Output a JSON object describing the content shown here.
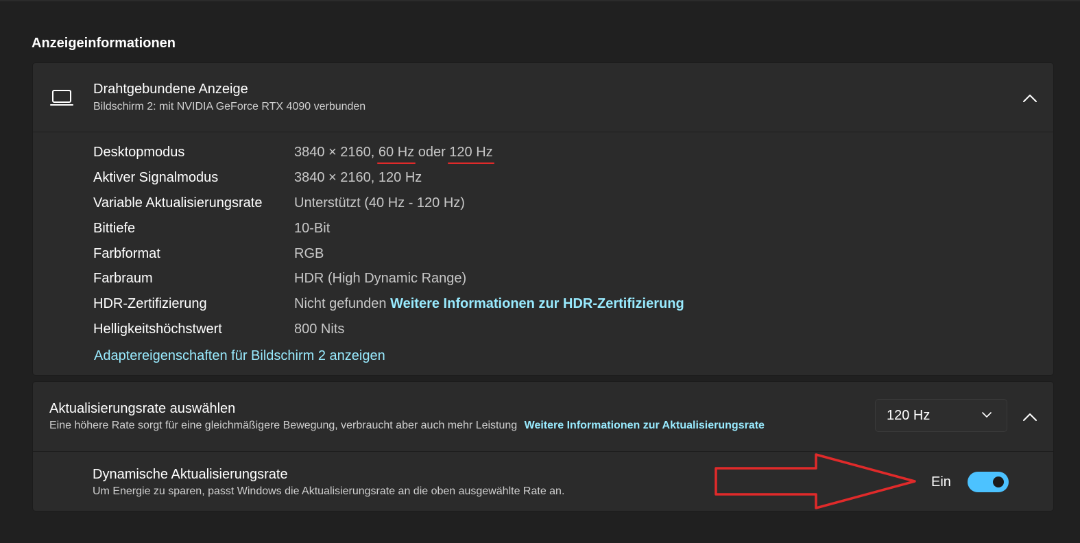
{
  "section_title": "Anzeigeinformationen",
  "display_card": {
    "title": "Drahtgebundene Anzeige",
    "subtitle": "Bildschirm 2: mit NVIDIA GeForce RTX 4090 verbunden",
    "icon": "laptop-icon",
    "expanded": true,
    "rows": [
      {
        "label": "Desktopmodus",
        "value_prefix": "3840 × 2160, ",
        "value_hz1": "60 Hz",
        "value_mid": " oder ",
        "value_hz2": "120 Hz"
      },
      {
        "label": "Aktiver Signalmodus",
        "value": "3840 × 2160, 120 Hz"
      },
      {
        "label": "Variable Aktualisierungsrate",
        "value": "Unterstützt (40 Hz - 120 Hz)"
      },
      {
        "label": "Bittiefe",
        "value": "10-Bit"
      },
      {
        "label": "Farbformat",
        "value": "RGB"
      },
      {
        "label": "Farbraum",
        "value": "HDR (High Dynamic Range)"
      },
      {
        "label": "HDR-Zertifizierung",
        "value": "Nicht gefunden",
        "link": "Weitere Informationen zur HDR-Zertifizierung"
      },
      {
        "label": "Helligkeitshöchstwert",
        "value": "800 Nits"
      }
    ],
    "adapter_link": "Adaptereigenschaften für Bildschirm 2 anzeigen"
  },
  "refresh_card": {
    "title": "Aktualisierungsrate auswählen",
    "subtitle": "Eine höhere Rate sorgt für eine gleichmäßigere Bewegung, verbraucht aber auch mehr Leistung",
    "link": "Weitere Informationen zur Aktualisierungsrate",
    "selected_rate": "120 Hz",
    "dynamic": {
      "title": "Dynamische Aktualisierungsrate",
      "subtitle": "Um Energie zu sparen, passt Windows die Aktualisierungsrate an die oben ausgewählte Rate an.",
      "state_label": "Ein",
      "enabled": true
    }
  },
  "colors": {
    "background": "#202020",
    "card": "#2b2b2b",
    "accent": "#4cc2ff",
    "link": "#99ebff",
    "annotation": "#e02a2a"
  }
}
